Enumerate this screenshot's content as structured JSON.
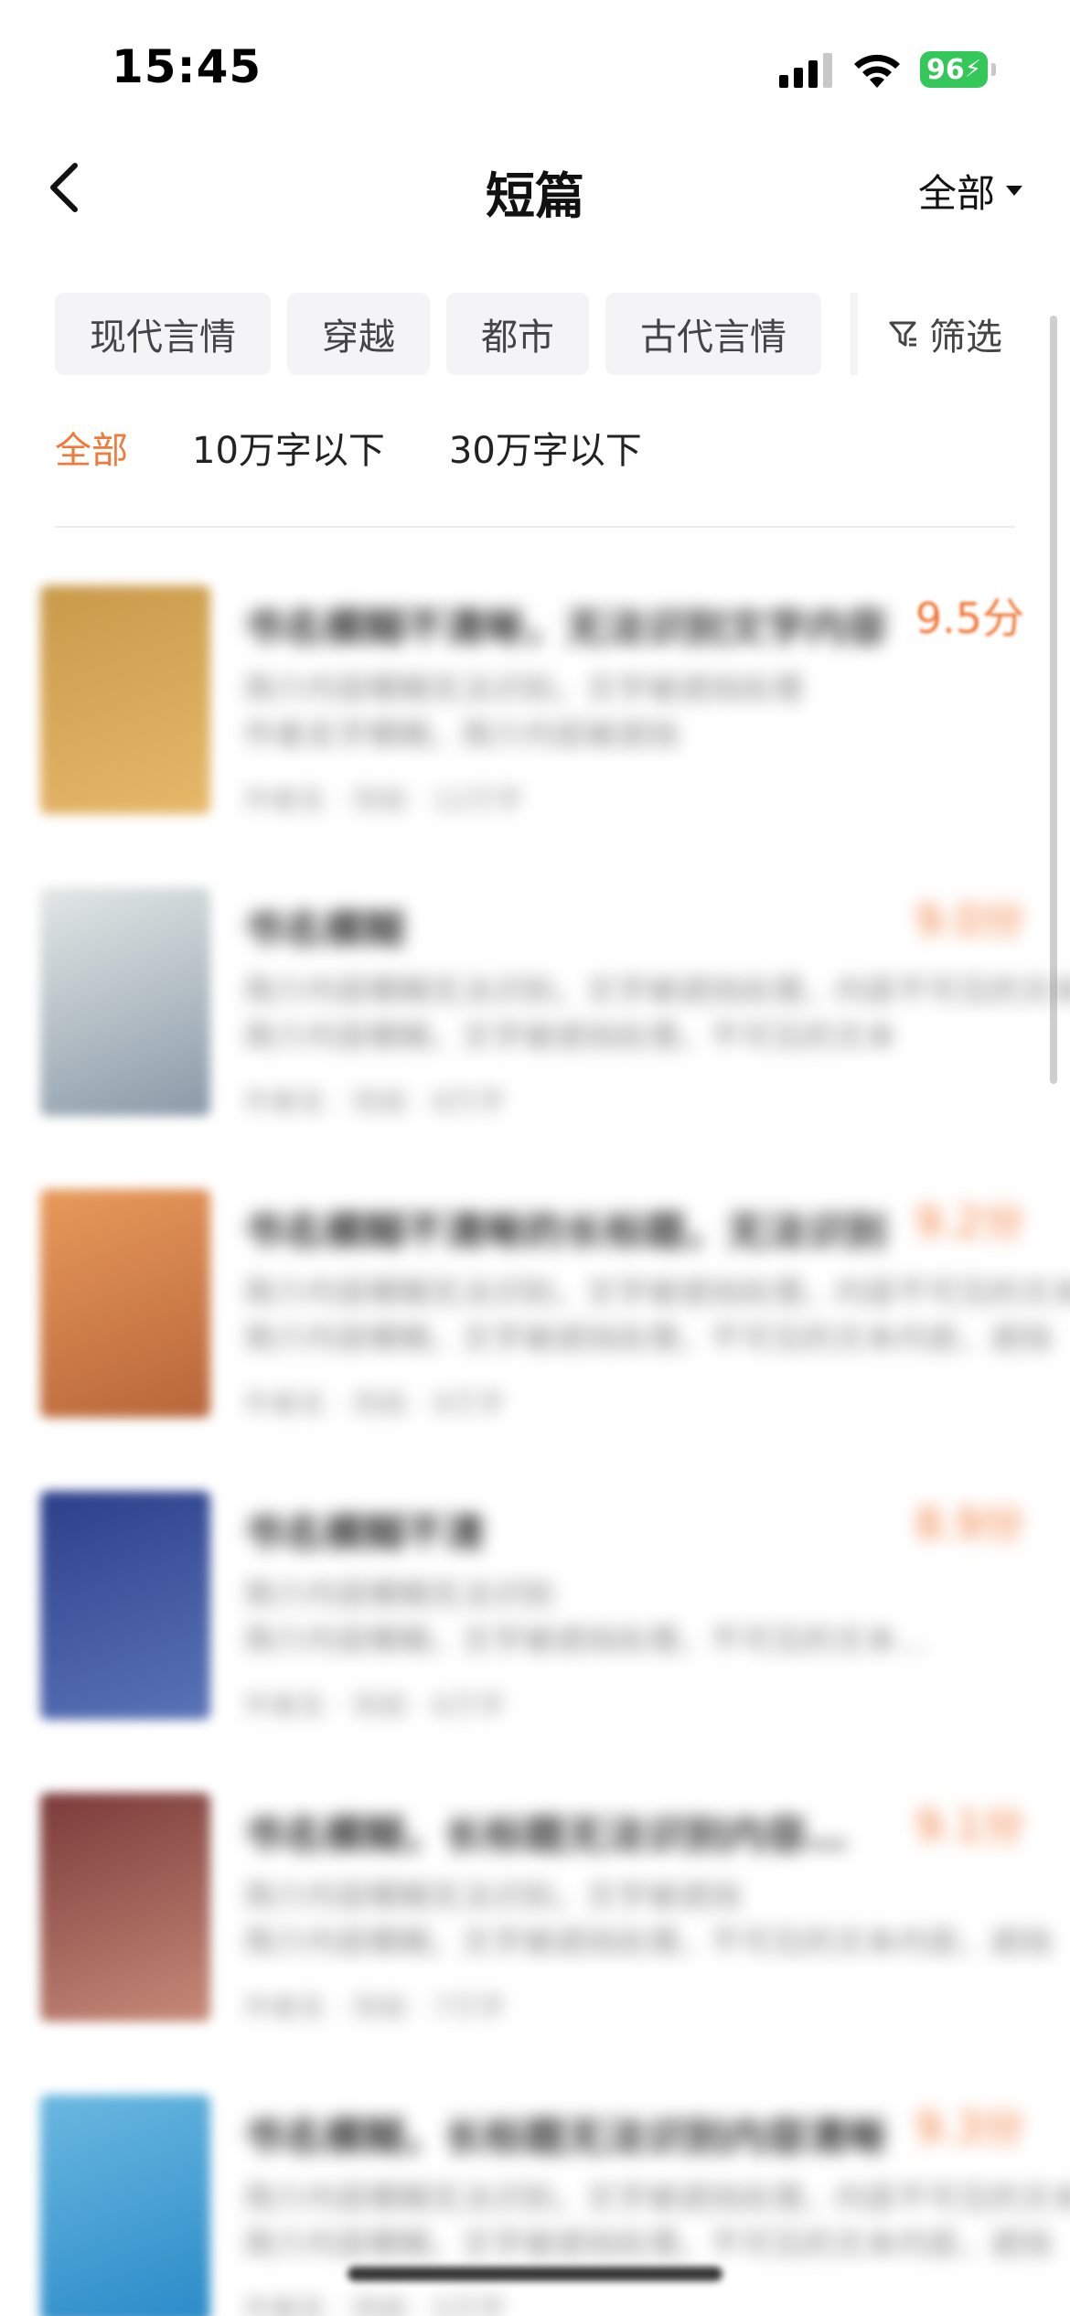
{
  "status_bar": {
    "time": "15:45",
    "battery": "96",
    "battery_color": "#34c759"
  },
  "nav": {
    "title": "短篇",
    "filter_label": "全部",
    "back_icon": "chevron-left-icon"
  },
  "categories": [
    "现代言情",
    "穿越",
    "都市",
    "古代言情"
  ],
  "filter_button": {
    "label": "筛选",
    "icon": "funnel-icon"
  },
  "word_count_tabs": [
    {
      "label": "全部",
      "active": true
    },
    {
      "label": "10万字以下",
      "active": false
    },
    {
      "label": "30万字以下",
      "active": false
    }
  ],
  "accent_color": "#f07a3a",
  "books": [
    {
      "title": "书名模糊不清晰，无法识别文字内容",
      "line1": "简介内容模糊无法识别，文字被遮挡处理",
      "line2": "作者名字模糊，简介内容被遮挡",
      "meta": "作者名 · 完结 · 12万字",
      "score": "9.5分",
      "cover_colors": [
        "#c99a4a",
        "#e8b86a"
      ]
    },
    {
      "title": "书名模糊",
      "line1": "简介内容模糊无法识别，文字被遮挡处理，内容不可见的文本",
      "line2": "简介内容模糊，文字被遮挡处理，不可见的文本",
      "meta": "作者名 · 完结 · 8万字",
      "score": "9.0分",
      "cover_colors": [
        "#e3e8e6",
        "#8a99a8"
      ]
    },
    {
      "title": "书名模糊不清晰的长标题，无法识别",
      "line1": "简介内容模糊无法识别，文字被遮挡处理，内容不可见的文本内容",
      "line2": "简介内容模糊，文字被遮挡处理，不可见的文本内容，遮挡",
      "meta": "作者名 · 完结 · 9万字",
      "score": "9.2分",
      "cover_colors": [
        "#e89a5a",
        "#b8653a"
      ]
    },
    {
      "title": "书名模糊不清",
      "line1": "简介内容模糊无法识别",
      "line2": "简介内容模糊，文字被遮挡处理，不可见的文本…",
      "meta": "作者名 · 完结 · 6万字",
      "score": "8.9分",
      "cover_colors": [
        "#2c3f8a",
        "#5a74b8"
      ]
    },
    {
      "title": "书名模糊，长标题无法识别内容…",
      "line1": "简介内容模糊无法识别，文字被遮挡",
      "line2": "简介内容模糊，文字被遮挡处理，不可见的文本内容，遮挡",
      "meta": "作者名 · 完结 · 7万字",
      "score": "9.1分",
      "cover_colors": [
        "#7a3a3a",
        "#c78a78"
      ]
    },
    {
      "title": "书名模糊，长标题无法识别内容清晰",
      "line1": "简介内容模糊无法识别，文字被遮挡处理，内容不可见的文本",
      "line2": "简介内容模糊，文字被遮挡处理，不可见的文本内容，遮挡",
      "meta": "作者名 · 完结 · 5万字",
      "score": "9.3分",
      "cover_colors": [
        "#6ab8e0",
        "#2a8ac8"
      ]
    }
  ]
}
